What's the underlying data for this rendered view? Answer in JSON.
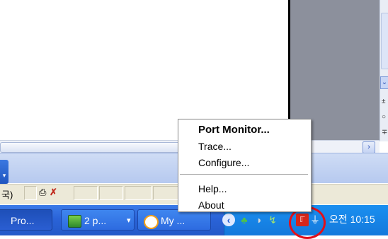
{
  "context_menu": {
    "items": [
      {
        "label": "Port Monitor...",
        "default": true
      },
      {
        "label": "Trace..."
      },
      {
        "label": "Configure..."
      },
      {
        "label": "Help..."
      },
      {
        "label": "About"
      }
    ]
  },
  "status_bar": {
    "text": "국)"
  },
  "taskbar": {
    "buttons": [
      {
        "label": "Pro..."
      },
      {
        "label": "2 p...",
        "dropdown": "▾"
      },
      {
        "label": "My ..."
      }
    ]
  },
  "tray": {
    "clock": "오전 10:15"
  },
  "colors": {
    "taskbar_blue": "#2a63d8",
    "tray_blue": "#1479dc",
    "highlight_circle": "#e3101a"
  }
}
